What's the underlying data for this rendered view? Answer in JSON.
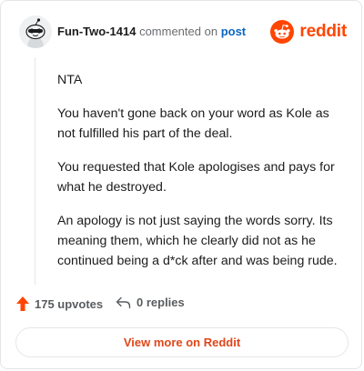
{
  "header": {
    "username": "Fun-Two-1414",
    "action_text": "commented on",
    "post_link": "post",
    "brand_name": "reddit"
  },
  "comment": {
    "paragraphs": [
      "NTA",
      "You haven't gone back on your word as Kole as not fulfilled his part of the deal.",
      "You requested that Kole apologises and pays for what he destroyed.",
      "An apology is not just saying the words sorry. Its meaning them, which he clearly did not as he continued being a d*ck after and was being rude."
    ]
  },
  "footer": {
    "upvotes": "175 upvotes",
    "replies": "0 replies",
    "view_more": "View more on Reddit"
  },
  "colors": {
    "brand": "#ff4500",
    "link": "#0a66c2",
    "upvote": "#ff4500"
  },
  "icons": [
    "avatar-icon",
    "reddit-logo-icon",
    "upvote-arrow-icon",
    "reply-arrow-icon"
  ]
}
